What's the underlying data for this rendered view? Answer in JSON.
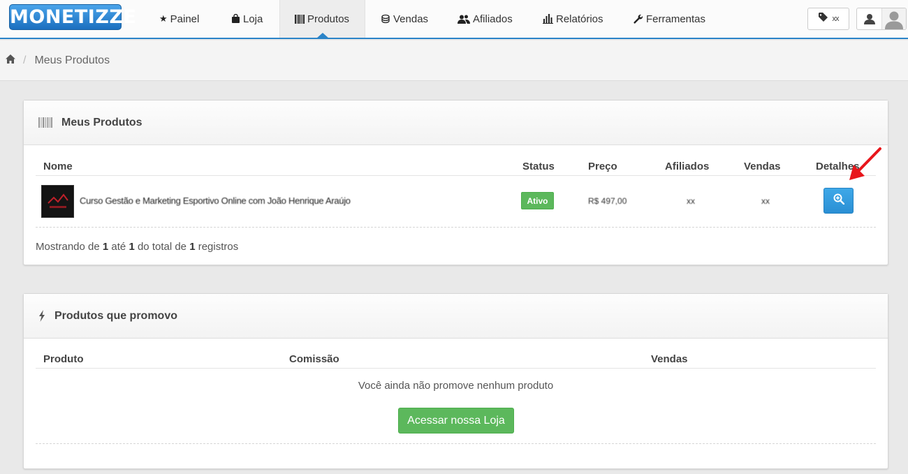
{
  "brand": {
    "logo_text": "MONETIZZE"
  },
  "nav": {
    "items": [
      {
        "label": "Painel",
        "icon": "star-icon"
      },
      {
        "label": "Loja",
        "icon": "bag-icon"
      },
      {
        "label": "Produtos",
        "icon": "barcode-icon",
        "active": true
      },
      {
        "label": "Vendas",
        "icon": "coins-icon"
      },
      {
        "label": "Afiliados",
        "icon": "users-icon"
      },
      {
        "label": "Relatórios",
        "icon": "bar-chart-icon"
      },
      {
        "label": "Ferramentas",
        "icon": "wrench-icon"
      }
    ],
    "tag_button_text": "xx"
  },
  "breadcrumb": {
    "current": "Meus Produtos"
  },
  "my_products": {
    "title": "Meus Produtos",
    "columns": [
      "Nome",
      "Status",
      "Preço",
      "Afiliados",
      "Vendas",
      "Detalhes"
    ],
    "rows": [
      {
        "name": "Curso Gestão e Marketing Esportivo Online com João Henrique Araújo",
        "status": "Ativo",
        "price": "R$ 497,00",
        "affiliates": "xx",
        "sales": "xx"
      }
    ],
    "footer": {
      "prefix": "Mostrando de",
      "from": "1",
      "mid": "até",
      "to": "1",
      "mid2": "do total de",
      "total": "1",
      "suffix": "registros"
    }
  },
  "promoted": {
    "title": "Produtos que promovo",
    "columns": [
      "Produto",
      "Comissão",
      "Vendas"
    ],
    "empty_text": "Você ainda não promove nenhum produto",
    "store_button": "Acessar nossa Loja"
  },
  "colors": {
    "accent": "#2b84c8",
    "success": "#5cb85c",
    "info": "#2a8fd4",
    "annotation": "#e8161b"
  }
}
